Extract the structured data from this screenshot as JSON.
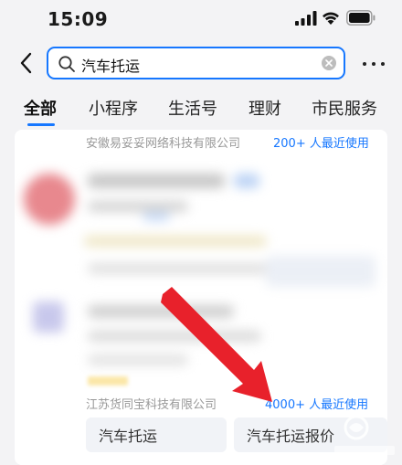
{
  "status_bar": {
    "time": "15:09"
  },
  "search": {
    "query": "汽车托运"
  },
  "tabs": [
    {
      "label": "全部",
      "active": true
    },
    {
      "label": "小程序",
      "active": false
    },
    {
      "label": "生活号",
      "active": false
    },
    {
      "label": "理财",
      "active": false
    },
    {
      "label": "市民服务",
      "active": false
    }
  ],
  "result_top": {
    "company": "安徽易妥妥网络科技有限公司",
    "usage": "200+ 人最近使用"
  },
  "result_bottom": {
    "company": "江苏货同宝科技有限公司",
    "usage": "4000+ 人最近使用",
    "services": [
      "汽车托运",
      "汽车托运报价"
    ]
  },
  "colors": {
    "accent": "#1677ff",
    "arrow": "#e8212b"
  }
}
